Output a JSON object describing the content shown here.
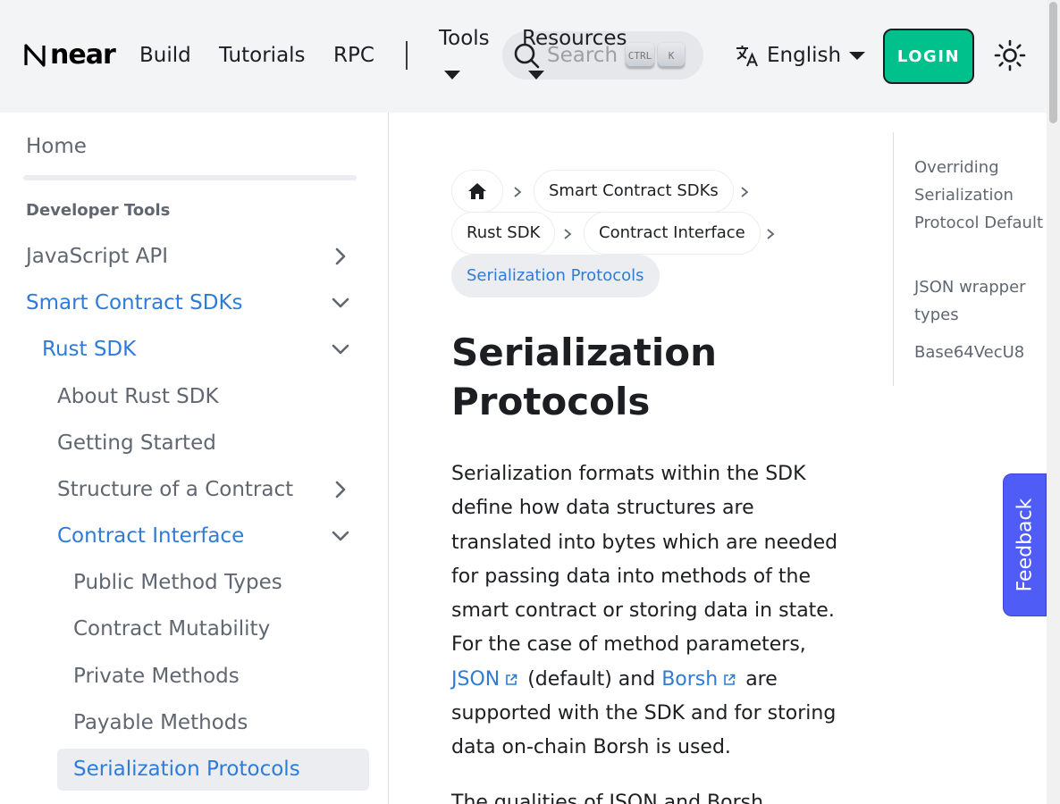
{
  "navbar": {
    "logo_text": "near",
    "links": [
      "Build",
      "Tutorials",
      "RPC"
    ],
    "tools_label": "Tools",
    "resources_label": "Resources",
    "search_placeholder": "Search",
    "kbd_ctrl": "CTRL",
    "kbd_k": "K",
    "language": "English",
    "login_label": "LOGIN"
  },
  "sidebar": {
    "home": "Home",
    "category": "Developer Tools",
    "items": [
      {
        "label": "JavaScript API",
        "chevron": "right"
      },
      {
        "label": "Smart Contract SDKs",
        "chevron": "down",
        "active": true
      },
      {
        "label": "Rust SDK",
        "chevron": "down",
        "active": true
      },
      {
        "label": "About Rust SDK"
      },
      {
        "label": "Getting Started"
      },
      {
        "label": "Structure of a Contract",
        "chevron": "right"
      },
      {
        "label": "Contract Interface",
        "chevron": "down",
        "active": true
      },
      {
        "label": "Public Method Types"
      },
      {
        "label": "Contract Mutability"
      },
      {
        "label": "Private Methods"
      },
      {
        "label": "Payable Methods"
      },
      {
        "label": "Serialization Protocols",
        "active": true,
        "selected": true
      }
    ]
  },
  "breadcrumbs": [
    "Smart Contract SDKs",
    "Rust SDK",
    "Contract Interface",
    "Serialization Protocols"
  ],
  "main": {
    "title": "Serialization Protocols",
    "para_before_json": "Serialization formats within the SDK define how data structures are translated into bytes which are needed for passing data into methods of the smart contract or storing data in state. For the case of method parameters, ",
    "link_json": "JSON",
    "para_between": " (default) and ",
    "link_borsh": "Borsh",
    "para_after": " are supported with the SDK and for storing data on-chain Borsh is used.",
    "next_para_start": "The qualities of JSON and Borsh"
  },
  "toc": {
    "items": [
      "Overriding Serialization Protocol Default",
      "JSON wrapper types",
      "Base64VecU8"
    ]
  },
  "feedback_label": "Feedback",
  "colors": {
    "accent": "#2f7bd8",
    "login": "#00c08b",
    "feedback": "#4f5df6"
  }
}
